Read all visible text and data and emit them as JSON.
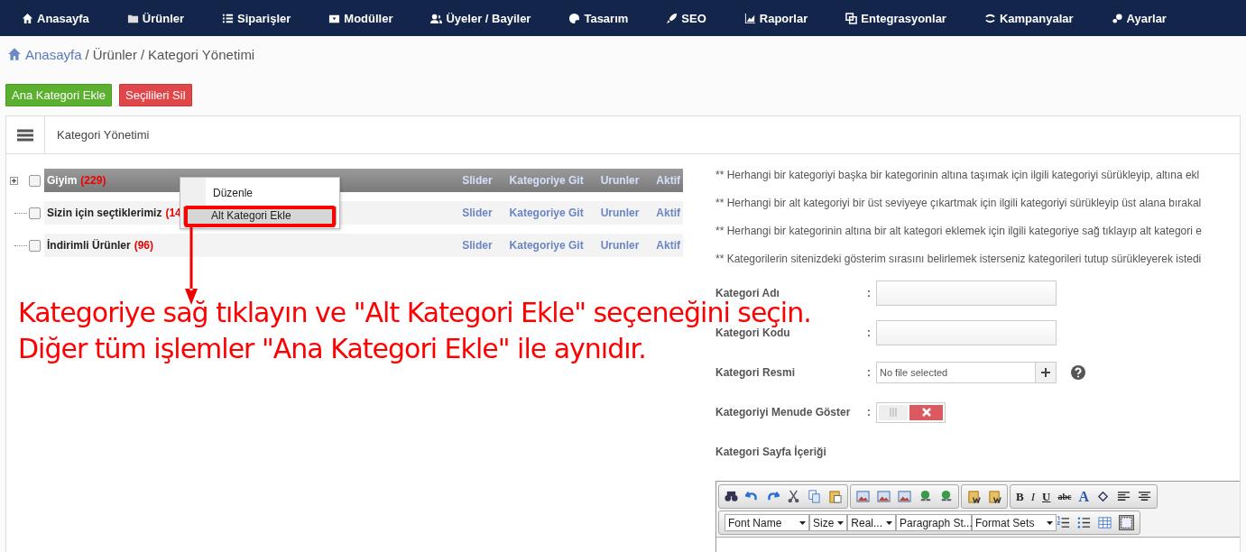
{
  "nav": [
    {
      "label": "Anasayfa"
    },
    {
      "label": "Ürünler"
    },
    {
      "label": "Siparişler"
    },
    {
      "label": "Modüller"
    },
    {
      "label": "Üyeler / Bayiler"
    },
    {
      "label": "Tasarım"
    },
    {
      "label": "SEO"
    },
    {
      "label": "Raporlar"
    },
    {
      "label": "Entegrasyonlar"
    },
    {
      "label": "Kampanyalar"
    },
    {
      "label": "Ayarlar"
    }
  ],
  "breadcrumb": {
    "home": "Anasayfa",
    "separator_1": "/",
    "current_1": "Ürünler",
    "separator_2": "/",
    "current_2": "Kategori Yönetimi"
  },
  "actions": [
    {
      "label": "Ana Kategori Ekle",
      "kind": "add"
    },
    {
      "label": "Seçilileri Sil",
      "kind": "delete"
    }
  ],
  "panel": {
    "title": "Kategori Yönetimi"
  },
  "tree": [
    {
      "name": "Giyim",
      "count": "(229)",
      "selected": true,
      "checked": false,
      "expandable": true,
      "links": [
        "Slider",
        "Kategoriye Git",
        "Urunler",
        "Aktif"
      ]
    },
    {
      "name": "Sizin için seçtiklerimiz",
      "count": "(14",
      "selected": false,
      "checked": false,
      "expandable": false,
      "links": [
        "Slider",
        "Kategoriye Git",
        "Urunler",
        "Aktif"
      ]
    },
    {
      "name": "İndirimli Ürünler",
      "count": "(96)",
      "selected": false,
      "checked": false,
      "expandable": false,
      "links": [
        "Slider",
        "Kategoriye Git",
        "Urunler",
        "Aktif"
      ]
    }
  ],
  "context_menu": {
    "items": [
      {
        "label": "Düzenle",
        "selected": false
      },
      {
        "label": "Alt Kategori Ekle",
        "selected": true
      }
    ]
  },
  "annotation": {
    "lines": [
      "Kategoriye sağ tıklayın ve \"Alt Kategori Ekle\" seçeneğini seçin.",
      "Diğer tüm işlemler \"Ana Kategori Ekle\" ile aynıdır."
    ]
  },
  "notes": [
    "** Herhangi bir kategoriyi başka bir kategorinin altına taşımak için ilgili kategoriyi sürükleyip, altına ekl",
    "** Herhangi bir alt kategoriyi bir üst seviyeye çıkartmak için ilgili kategoriyi sürükleyip üst alana bırakal",
    "** Herhangi bir kategorinin altına bir alt kategori eklemek için ilgili kategoriye sağ tıklayıp alt kategori e",
    "** Kategorilerin sitenizdeki gösterim sırasını belirlemek isterseniz kategorileri tutup sürükleyerek istedi"
  ],
  "form": [
    {
      "kind": "text",
      "label": "Kategori Adı",
      "colon": ":"
    },
    {
      "kind": "text",
      "label": "Kategori Kodu",
      "colon": ":"
    },
    {
      "kind": "file",
      "label": "Kategori Resmi",
      "colon": ":",
      "placeholder": "No file selected"
    },
    {
      "kind": "toggle",
      "label": "Kategoriyi Menude Göster",
      "colon": ":",
      "on": false
    },
    {
      "kind": "heading",
      "label": "Kategori Sayfa İçeriği"
    }
  ],
  "editor": {
    "format_buttons": [
      "B",
      "I",
      "U",
      "abc",
      "A"
    ],
    "dropdowns": [
      "Font Name",
      "Size",
      "Real...",
      "Paragraph St...",
      "Format Sets"
    ]
  }
}
